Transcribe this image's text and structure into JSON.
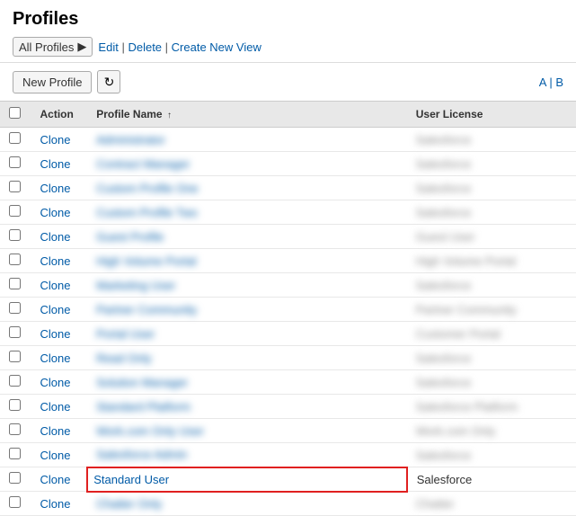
{
  "page": {
    "title": "Profiles",
    "view_selector": "All Profiles",
    "view_links": [
      "Edit",
      "Delete",
      "Create New View"
    ],
    "toolbar": {
      "new_profile_label": "New Profile",
      "pagination_a": "A",
      "pagination_b": "B"
    },
    "table": {
      "columns": [
        {
          "id": "check",
          "label": ""
        },
        {
          "id": "action",
          "label": "Action"
        },
        {
          "id": "profile_name",
          "label": "Profile Name",
          "sorted": "asc"
        },
        {
          "id": "user_license",
          "label": "User License"
        }
      ],
      "rows": [
        {
          "id": 1,
          "action": "Clone",
          "profile_name": "",
          "profile_name_blurred": true,
          "user_license": "",
          "license_blurred": true,
          "highlighted": false
        },
        {
          "id": 2,
          "action": "Clone",
          "profile_name": "",
          "profile_name_blurred": true,
          "user_license": "",
          "license_blurred": true,
          "highlighted": false
        },
        {
          "id": 3,
          "action": "Clone",
          "profile_name": "",
          "profile_name_blurred": true,
          "user_license": "",
          "license_blurred": true,
          "highlighted": false
        },
        {
          "id": 4,
          "action": "Clone",
          "profile_name": "",
          "profile_name_blurred": true,
          "user_license": "",
          "license_blurred": true,
          "highlighted": false
        },
        {
          "id": 5,
          "action": "Clone",
          "profile_name": "",
          "profile_name_blurred": true,
          "user_license": "",
          "license_blurred": true,
          "highlighted": false
        },
        {
          "id": 6,
          "action": "Clone",
          "profile_name": "",
          "profile_name_blurred": true,
          "user_license": "",
          "license_blurred": true,
          "highlighted": false
        },
        {
          "id": 7,
          "action": "Clone",
          "profile_name": "",
          "profile_name_blurred": true,
          "user_license": "",
          "license_blurred": true,
          "highlighted": false
        },
        {
          "id": 8,
          "action": "Clone",
          "profile_name": "",
          "profile_name_blurred": true,
          "user_license": "",
          "license_blurred": true,
          "highlighted": false
        },
        {
          "id": 9,
          "action": "Clone",
          "profile_name": "",
          "profile_name_blurred": true,
          "user_license": "",
          "license_blurred": true,
          "highlighted": false
        },
        {
          "id": 10,
          "action": "Clone",
          "profile_name": "",
          "profile_name_blurred": true,
          "user_license": "",
          "license_blurred": true,
          "highlighted": false
        },
        {
          "id": 11,
          "action": "Clone",
          "profile_name": "",
          "profile_name_blurred": true,
          "user_license": "",
          "license_blurred": true,
          "highlighted": false
        },
        {
          "id": 12,
          "action": "Clone",
          "profile_name": "",
          "profile_name_blurred": true,
          "user_license": "",
          "license_blurred": true,
          "highlighted": false
        },
        {
          "id": 13,
          "action": "Clone",
          "profile_name": "",
          "profile_name_blurred": true,
          "user_license": "",
          "license_blurred": true,
          "highlighted": false
        },
        {
          "id": 14,
          "action": "Clone",
          "profile_name": "",
          "profile_name_blurred": true,
          "user_license": "",
          "license_blurred": true,
          "highlighted": false
        },
        {
          "id": 15,
          "action": "Clone",
          "profile_name": "Standard User",
          "profile_name_blurred": false,
          "user_license": "Salesforce",
          "license_blurred": false,
          "highlighted": true
        },
        {
          "id": 16,
          "action": "Clone",
          "profile_name": "",
          "profile_name_blurred": true,
          "user_license": "",
          "license_blurred": true,
          "highlighted": false
        }
      ]
    }
  }
}
